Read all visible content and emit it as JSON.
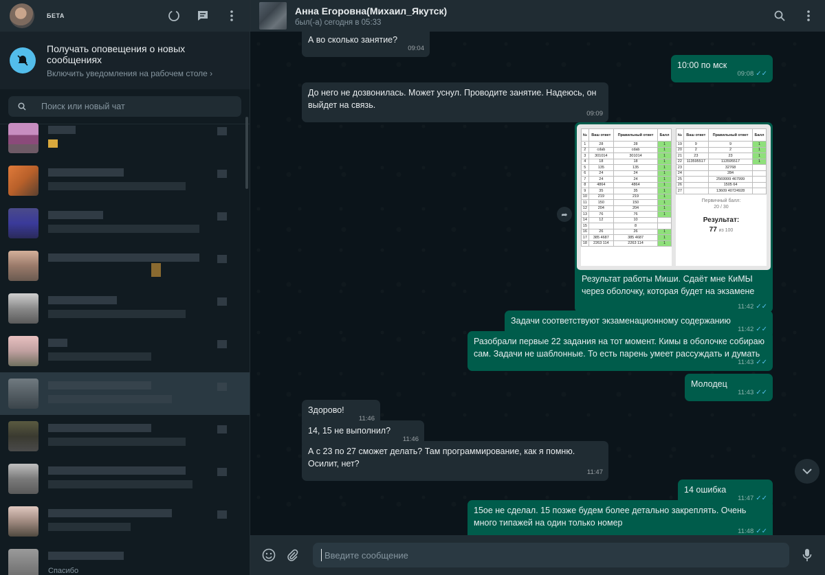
{
  "sidebar": {
    "beta_label": "БЕТА",
    "notification": {
      "title": "Получать оповещения о новых сообщениях",
      "subtitle": "Включить уведомления на рабочем столе ›"
    },
    "search_placeholder": "Поиск или новый чат",
    "peek_text": "Спасибо"
  },
  "chat": {
    "contact_name": "Анна Егоровна(Михаил_Якутск)",
    "status": "был(-а) сегодня в 05:33",
    "input_placeholder": "Введите сообщение",
    "messages": [
      {
        "dir": "in",
        "text": "А во сколько занятие?",
        "time": "09:04"
      },
      {
        "dir": "out",
        "text": "10:00 по мск",
        "time": "09:08"
      },
      {
        "dir": "in",
        "text": "До него не дозвонилась. Может уснул. Проводите занятие. Надеюсь, он выйдет на связь.",
        "time": "09:09"
      },
      {
        "dir": "out",
        "text": "Результат работы Миши. Сдаёт мне КиМЫ через оболочку, которая будет на экзамене",
        "time": "11:42"
      },
      {
        "dir": "out",
        "text": "Задачи соответствуют экзаменационному содержанию",
        "time": "11:42"
      },
      {
        "dir": "out",
        "text": "Разобрали первые 22 задания на тот момент. Кимы в оболочке собираю сам. Задачи не шаблонные. То есть парень умеет рассуждать и думать",
        "time": "11:43"
      },
      {
        "dir": "out",
        "text": "Молодец",
        "time": "11:43"
      },
      {
        "dir": "in",
        "text": "Здорово!",
        "time": "11:46"
      },
      {
        "dir": "in",
        "text": "14, 15 не выполнил?",
        "time": "11:46"
      },
      {
        "dir": "in",
        "text": "А с 23 по 27 сможет делать? Там программирование, как я помню. Осилит, нет?",
        "time": "11:47"
      },
      {
        "dir": "out",
        "text": "14 ошибка",
        "time": "11:47"
      },
      {
        "dir": "out",
        "text": "15ое не сделал. 15 позже будем более детально закреплять. Очень много типажей на один только номер",
        "time": "11:48"
      }
    ],
    "image": {
      "col_num": "№",
      "col_yours": "Ваш ответ",
      "col_correct": "Правильный ответ",
      "col_score": "Балл",
      "primary_label": "Первичный балл:",
      "primary_value": "20 / 30",
      "result_label": "Результат:",
      "result_value": "77",
      "result_of": "из 100"
    }
  },
  "colors": {
    "accent": "#00a884",
    "outgoing": "#005c4b",
    "incoming": "#202c33",
    "read_ticks": "#53bdeb"
  }
}
